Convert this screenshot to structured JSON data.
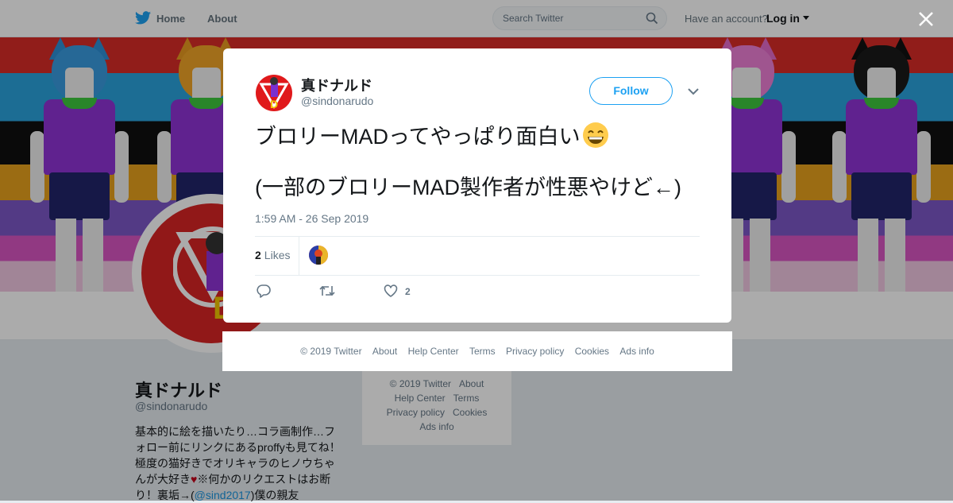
{
  "topnav": {
    "home_label": "Home",
    "about_label": "About",
    "search_placeholder": "Search Twitter",
    "have_account": "Have an account?",
    "login_label": "Log in"
  },
  "profile": {
    "name": "真ドナルド",
    "handle": "@sindonarudo",
    "bio_part1": "基本的に絵を描いたり…コラ画制作…フォロー前にリンクにあるproffyも見てね！極度の猫好きでオリキャラのヒノウちゃんが大好き",
    "bio_heart": "♥",
    "bio_part2": "※何かのリクエストはお断り！裏垢→(",
    "bio_link": "@sind2017",
    "bio_part3": ")僕の親友"
  },
  "bg_footer": {
    "copyright": "© 2019 Twitter",
    "about": "About",
    "help": "Help Center",
    "terms": "Terms",
    "privacy": "Privacy policy",
    "cookies": "Cookies",
    "ads": "Ads info"
  },
  "tweet": {
    "author_name": "真ドナルド",
    "author_handle": "@sindonarudo",
    "follow_label": "Follow",
    "text_line1": "ブロリーMADってやっぱり面白い",
    "text_line2": "(一部のブロリーMAD製作者が性悪やけど←)",
    "timestamp": "1:59 AM - 26 Sep 2019",
    "likes_count": "2",
    "likes_label": "Likes",
    "like_action_count": "2"
  },
  "modal_footer": {
    "copyright": "© 2019 Twitter",
    "about": "About",
    "help": "Help Center",
    "terms": "Terms",
    "privacy": "Privacy policy",
    "cookies": "Cookies",
    "ads": "Ads info"
  },
  "colors": {
    "twitter_blue": "#1da1f2",
    "text_primary": "#14171a",
    "text_secondary": "#657786",
    "avatar_red": "#e0191b"
  },
  "icons": [
    "twitter-bird-icon",
    "search-icon",
    "caret-down-icon",
    "close-icon",
    "chevron-down-icon",
    "reply-icon",
    "retweet-icon",
    "heart-icon",
    "grinning-emoji-icon"
  ]
}
